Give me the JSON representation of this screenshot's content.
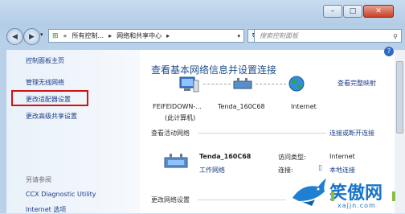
{
  "window": {
    "min": "–",
    "max": "□",
    "close": "✕"
  },
  "nav": {
    "back": "◀",
    "forward": "▶",
    "dropdown": "▾"
  },
  "address": {
    "sep1": "«",
    "crumb1": "所有控制...",
    "arrow1": "▸",
    "crumb2": "网络和共享中心",
    "arrow2": "▸",
    "dropdown": "▾",
    "refresh": "↻"
  },
  "search": {
    "placeholder": "搜索控制面板",
    "icon": "⚲"
  },
  "sidebar": {
    "home": "控制面板主页",
    "items": [
      "管理无线网络",
      "更改适配器设置",
      "更改高级共享设置"
    ],
    "see_also": "另请参阅",
    "see_also_items": [
      "CCX Diagnostic Utility",
      "Internet 选项"
    ]
  },
  "main": {
    "title": "查看基本网络信息并设置连接",
    "view_full_map": "查看完整映射",
    "help": "?",
    "nodes": [
      {
        "name": "FEIFEIDOWN-...",
        "sub": "(此计算机)"
      },
      {
        "name": "Tenda_160C68",
        "sub": ""
      },
      {
        "name": "Internet",
        "sub": ""
      }
    ],
    "active_header": "查看活动网络",
    "connect_link": "连接或断开连接",
    "network": {
      "name": "Tenda_160C68",
      "type": "工作网络"
    },
    "access_label": "访问类型:",
    "access_value": "Internet",
    "conn_label": "连接:",
    "conn_value": "本地连接",
    "change_header": "更改网络设置"
  },
  "watermark": {
    "brand": "笑傲网",
    "url": "xajjn.com"
  }
}
